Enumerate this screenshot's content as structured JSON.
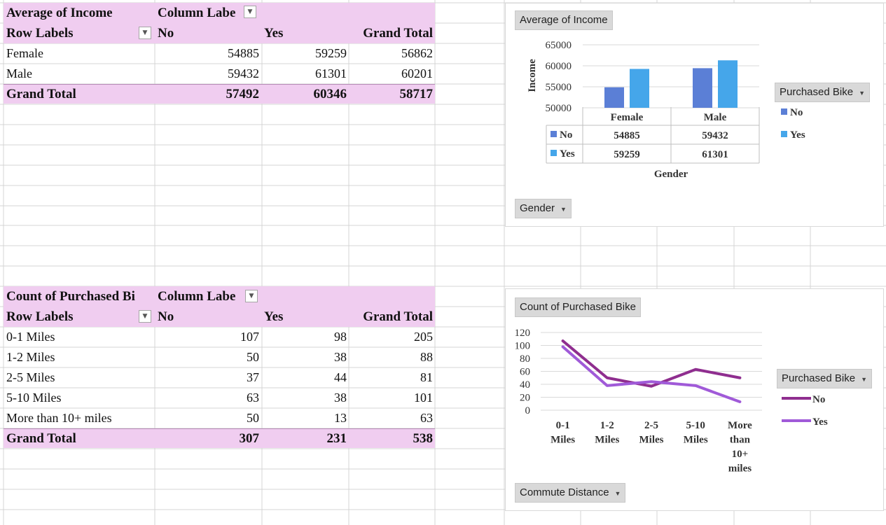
{
  "pivot_income": {
    "title": "Average of Income",
    "col_labels": "Column Labe",
    "row_labels": "Row Labels",
    "headers": [
      "No",
      "Yes",
      "Grand Total"
    ],
    "rows": [
      {
        "label": "Female",
        "no": "54885",
        "yes": "59259",
        "total": "56862"
      },
      {
        "label": "Male",
        "no": "59432",
        "yes": "61301",
        "total": "60201"
      }
    ],
    "grand": {
      "label": "Grand Total",
      "no": "57492",
      "yes": "60346",
      "total": "58717"
    }
  },
  "pivot_count": {
    "title": "Count of Purchased Bi",
    "col_labels": "Column Labe",
    "row_labels": "Row Labels",
    "headers": [
      "No",
      "Yes",
      "Grand Total"
    ],
    "rows": [
      {
        "label": "0-1 Miles",
        "no": "107",
        "yes": "98",
        "total": "205"
      },
      {
        "label": "1-2 Miles",
        "no": "50",
        "yes": "38",
        "total": "88"
      },
      {
        "label": "2-5 Miles",
        "no": "37",
        "yes": "44",
        "total": "81"
      },
      {
        "label": "5-10 Miles",
        "no": "63",
        "yes": "38",
        "total": "101"
      },
      {
        "label": "More than 10+ miles",
        "no": "50",
        "yes": "13",
        "total": "63"
      }
    ],
    "grand": {
      "label": "Grand Total",
      "no": "307",
      "yes": "231",
      "total": "538"
    }
  },
  "chart1": {
    "field_button": "Average of Income",
    "legend_button": "Purchased Bike",
    "axis_button": "Gender",
    "ylabel": "Income",
    "xlabel": "Gender",
    "colors": {
      "No": "#5b7fd6",
      "Yes": "#45a6ea"
    }
  },
  "chart2": {
    "field_button": "Count of Purchased Bike",
    "legend_button": "Purchased Bike",
    "axis_button": "Commute Distance",
    "colors": {
      "No": "#8f2e8f",
      "Yes": "#a05ad8"
    }
  },
  "chart_data": [
    {
      "type": "bar",
      "categories": [
        "Female",
        "Male"
      ],
      "series": [
        {
          "name": "No",
          "values": [
            54885,
            59432
          ]
        },
        {
          "name": "Yes",
          "values": [
            59259,
            61301
          ]
        }
      ],
      "title": "",
      "xlabel": "Gender",
      "ylabel": "Income",
      "ylim": [
        50000,
        65000
      ],
      "yticks": [
        "65000",
        "60000",
        "55000",
        "50000"
      ],
      "data_table": true,
      "legend": "right",
      "grid": true
    },
    {
      "type": "line",
      "categories": [
        "0-1 Miles",
        "1-2 Miles",
        "2-5 Miles",
        "5-10 Miles",
        "More than 10+ miles"
      ],
      "category_lines": [
        [
          "0-1",
          "Miles"
        ],
        [
          "1-2",
          "Miles"
        ],
        [
          "2-5",
          "Miles"
        ],
        [
          "5-10",
          "Miles"
        ],
        [
          "More",
          "than",
          "10+",
          "miles"
        ]
      ],
      "series": [
        {
          "name": "No",
          "values": [
            107,
            50,
            37,
            63,
            50
          ]
        },
        {
          "name": "Yes",
          "values": [
            98,
            38,
            44,
            38,
            13
          ]
        }
      ],
      "title": "",
      "xlabel": "",
      "ylabel": "",
      "ylim": [
        0,
        120
      ],
      "yticks": [
        "120",
        "100",
        "80",
        "60",
        "40",
        "20",
        "0"
      ],
      "legend": "right",
      "grid": true
    }
  ]
}
